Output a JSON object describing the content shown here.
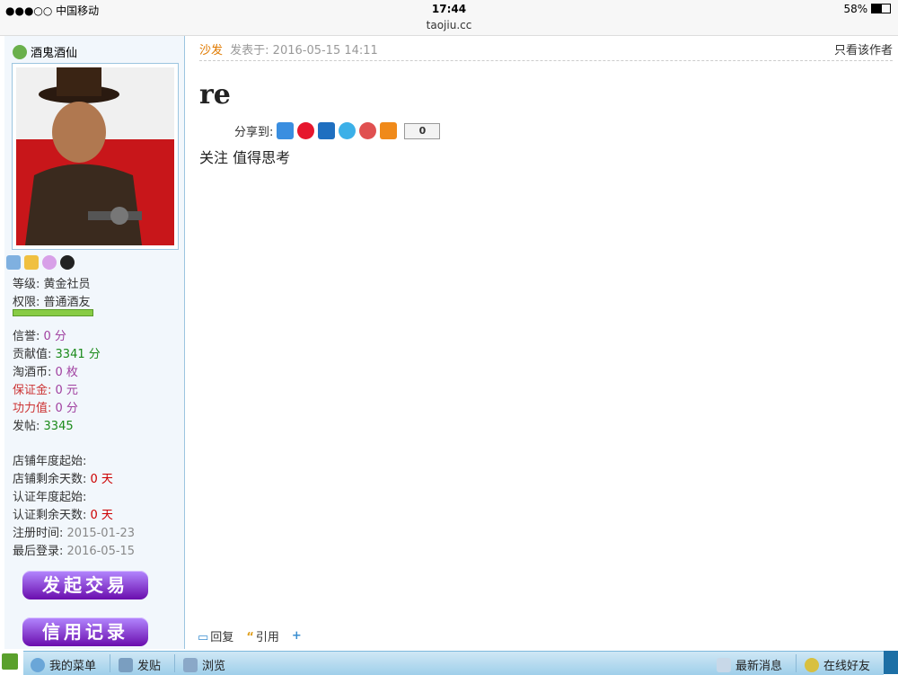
{
  "statusbar": {
    "carrier": "●●●○○ 中国移动 ",
    "time": "17:44",
    "battery": "58%"
  },
  "url": "taojiu.cc",
  "user": {
    "name": "酒鬼酒仙",
    "level_label": "等级:",
    "level_value": "黄金社员",
    "perm_label": "权限:",
    "perm_value": "普通酒友",
    "xinyu_label": "信誉:",
    "xinyu_value": "0 分",
    "gongxian_label": "贡献值:",
    "gongxian_value": "3341 分",
    "taojiu_label": "淘酒币:",
    "taojiu_value": "0 枚",
    "baozheng_label": "保证金:",
    "baozheng_value": "0 元",
    "gongli_label": "功力值:",
    "gongli_value": "0 分",
    "fatie_label": "发帖:",
    "fatie_value": "3345",
    "shop_start_label": "店铺年度起始:",
    "shop_days_label": "店铺剩余天数:",
    "shop_days_value": "0 天",
    "cert_start_label": "认证年度起始:",
    "cert_days_label": "认证剩余天数:",
    "cert_days_value": "0 天",
    "reg_label": "注册时间:",
    "reg_value": "2015-01-23",
    "last_label": "最后登录:",
    "last_value": "2016-05-15"
  },
  "buttons": {
    "trade": "发起交易",
    "credit": "信用记录"
  },
  "post": {
    "sofa": "沙发",
    "posted_at": "发表于: 2016-05-15 14:11",
    "only_author": "只看该作者",
    "title": "re",
    "share_label": "分享到:",
    "share_count": "0",
    "body": "关注 值得思考",
    "reply": "回复",
    "quote": "引用",
    "plus": "+"
  },
  "bottombar": {
    "my_menu": "我的菜单",
    "post": "发贴",
    "browse": "浏览",
    "news": "最新消息",
    "online": "在线好友"
  }
}
